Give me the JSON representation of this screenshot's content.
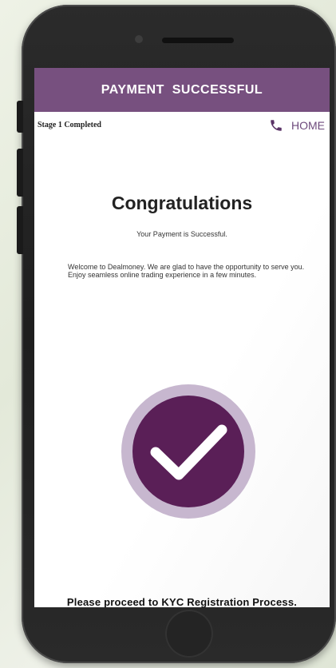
{
  "header": {
    "title": "PAYMENT  SUCCESSFUL"
  },
  "status_bar": {
    "stage": "Stage 1 Completed",
    "home_label": "HOME",
    "phone_icon": "phone-icon"
  },
  "main": {
    "heading": "Congratulations",
    "payment_message": "Your Payment is Successful.",
    "welcome_text": "Welcome to Dealmoney. We are glad to have the opportunity to serve you. Enjoy seamless online trading  experience in a few minutes.",
    "check_icon": "checkmark-icon",
    "proceed_text": "Please proceed to KYC Registration Process."
  },
  "colors": {
    "brand": "#77507f",
    "check_circle": "#5a1f57",
    "check_ring": "#c7b7cf",
    "background": "#ffffff"
  }
}
